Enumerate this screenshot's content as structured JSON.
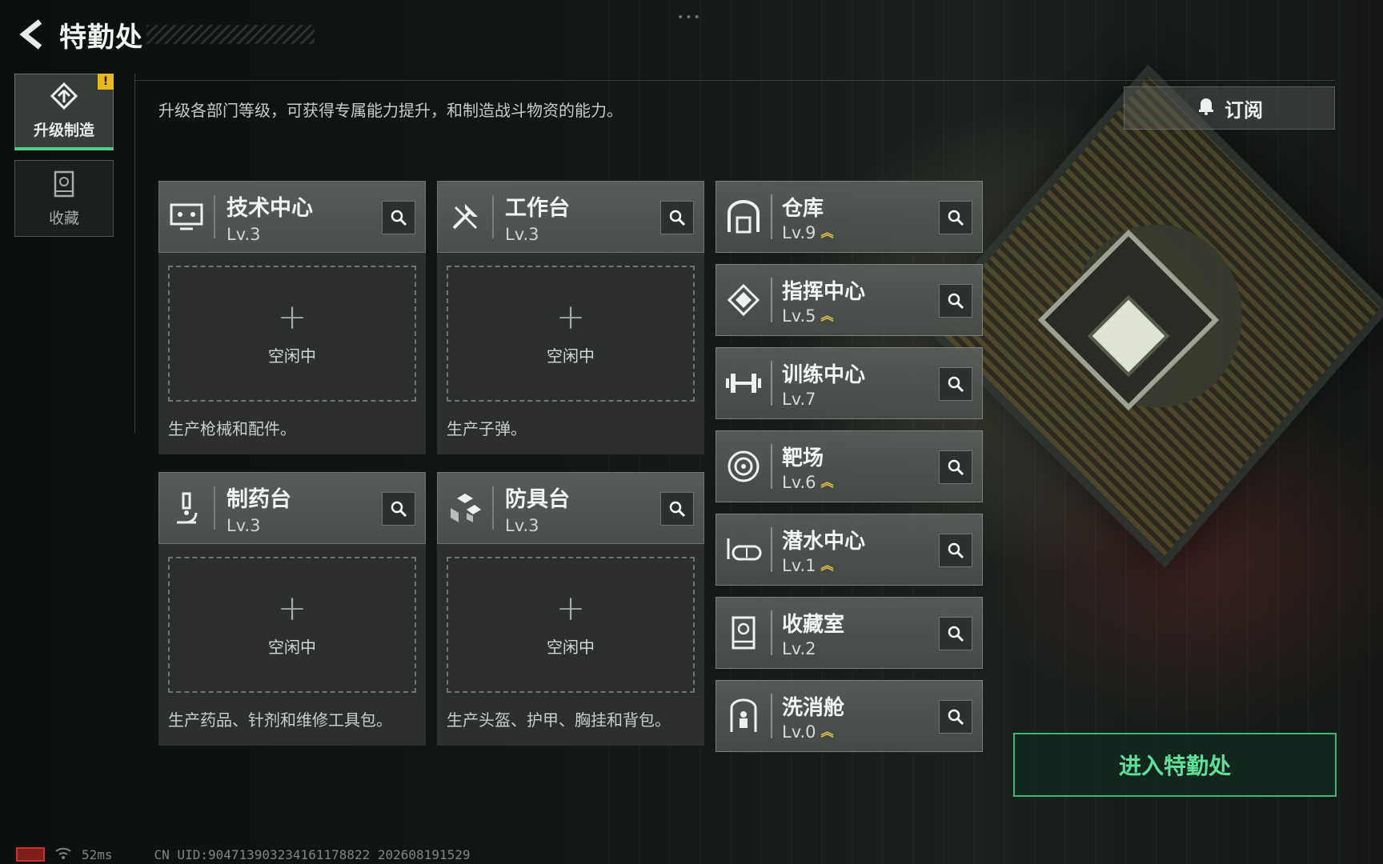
{
  "header": {
    "title": "特勤处"
  },
  "sidebar": {
    "items": [
      {
        "label": "升级制造",
        "active": true,
        "badge": "!"
      },
      {
        "label": "收藏",
        "active": false
      }
    ]
  },
  "description": "升级各部门等级，可获得专属能力提升，和制造战斗物资的能力。",
  "subscribe_label": "订阅",
  "production": [
    {
      "name": "技术中心",
      "level": "Lv.3",
      "slot_status": "空闲中",
      "desc": "生产枪械和配件。",
      "icon": "computer-icon"
    },
    {
      "name": "工作台",
      "level": "Lv.3",
      "slot_status": "空闲中",
      "desc": "生产子弹。",
      "icon": "tools-icon"
    },
    {
      "name": "制药台",
      "level": "Lv.3",
      "slot_status": "空闲中",
      "desc": "生产药品、针剂和维修工具包。",
      "icon": "microscope-icon"
    },
    {
      "name": "防具台",
      "level": "Lv.3",
      "slot_status": "空闲中",
      "desc": "生产头盔、护甲、胸挂和背包。",
      "icon": "armor-blocks-icon"
    }
  ],
  "facilities": [
    {
      "name": "仓库",
      "level": "Lv.9",
      "upgradable": true,
      "icon": "warehouse-icon"
    },
    {
      "name": "指挥中心",
      "level": "Lv.5",
      "upgradable": true,
      "icon": "command-icon"
    },
    {
      "name": "训练中心",
      "level": "Lv.7",
      "upgradable": false,
      "icon": "dumbbell-icon"
    },
    {
      "name": "靶场",
      "level": "Lv.6",
      "upgradable": true,
      "icon": "target-icon"
    },
    {
      "name": "潜水中心",
      "level": "Lv.1",
      "upgradable": true,
      "icon": "diving-mask-icon"
    },
    {
      "name": "收藏室",
      "level": "Lv.2",
      "upgradable": false,
      "icon": "display-case-icon"
    },
    {
      "name": "洗消舱",
      "level": "Lv.0",
      "upgradable": true,
      "icon": "decon-chamber-icon"
    }
  ],
  "plus_symbol": "+",
  "enter_button": "进入特勤处",
  "status_bar": {
    "ping": "52ms",
    "uid": "CN UID:904713903234161178822 202608191529"
  },
  "colors": {
    "accent_green": "#4fd08a",
    "upgrade_gold": "#e2c04a",
    "alert_yellow": "#e8b820"
  }
}
